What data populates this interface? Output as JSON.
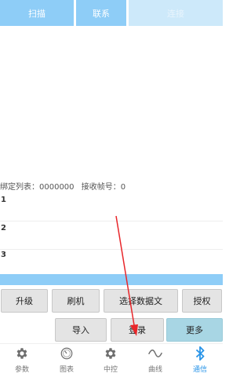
{
  "top_bar": {
    "scan_label": "扫描",
    "contact_label": "联系",
    "connect_label": "连接"
  },
  "info": {
    "bind_list": "绑定列表：0000000",
    "recv_frame": "接收帧号：0"
  },
  "rows": [
    {
      "num": "1"
    },
    {
      "num": "2"
    },
    {
      "num": "3"
    }
  ],
  "actions": {
    "upgrade": "升级",
    "flash": "刷机",
    "select_data": "选择数据文",
    "authorize": "授权",
    "import": "导入",
    "login": "登录",
    "more": "更多"
  },
  "nav": {
    "items": [
      {
        "label": "参数",
        "icon": "gear-icon"
      },
      {
        "label": "图表",
        "icon": "gauge-icon"
      },
      {
        "label": "中控",
        "icon": "gear-icon"
      },
      {
        "label": "曲线",
        "icon": "wave-icon"
      },
      {
        "label": "通信",
        "icon": "bluetooth-icon"
      }
    ],
    "active_index": 4
  },
  "colors": {
    "accent": "#8ecdf7",
    "nav_active": "#2a95e8",
    "annotation_arrow": "#e8262a"
  }
}
